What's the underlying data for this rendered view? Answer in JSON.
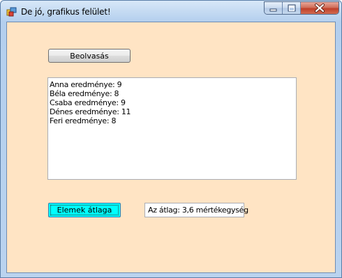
{
  "window": {
    "title": "De jó, grafikus felület!",
    "icon": "windows-form-icon",
    "controls": [
      "minimize-icon",
      "maximize-icon",
      "close-icon"
    ]
  },
  "colors": {
    "form_background": "#ffe4c4",
    "average_button_background": "#00ffff"
  },
  "main": {
    "read_button_label": "Beolvasás",
    "list_items": [
      "Anna eredménye: 9",
      "Béla eredménye: 8",
      "Csaba eredménye: 9",
      "Dénes eredménye: 11",
      "Feri eredménye: 8"
    ],
    "average_button_label": "Elemek átlaga",
    "average_result": "Az átlag: 3,6 mértékegység"
  }
}
